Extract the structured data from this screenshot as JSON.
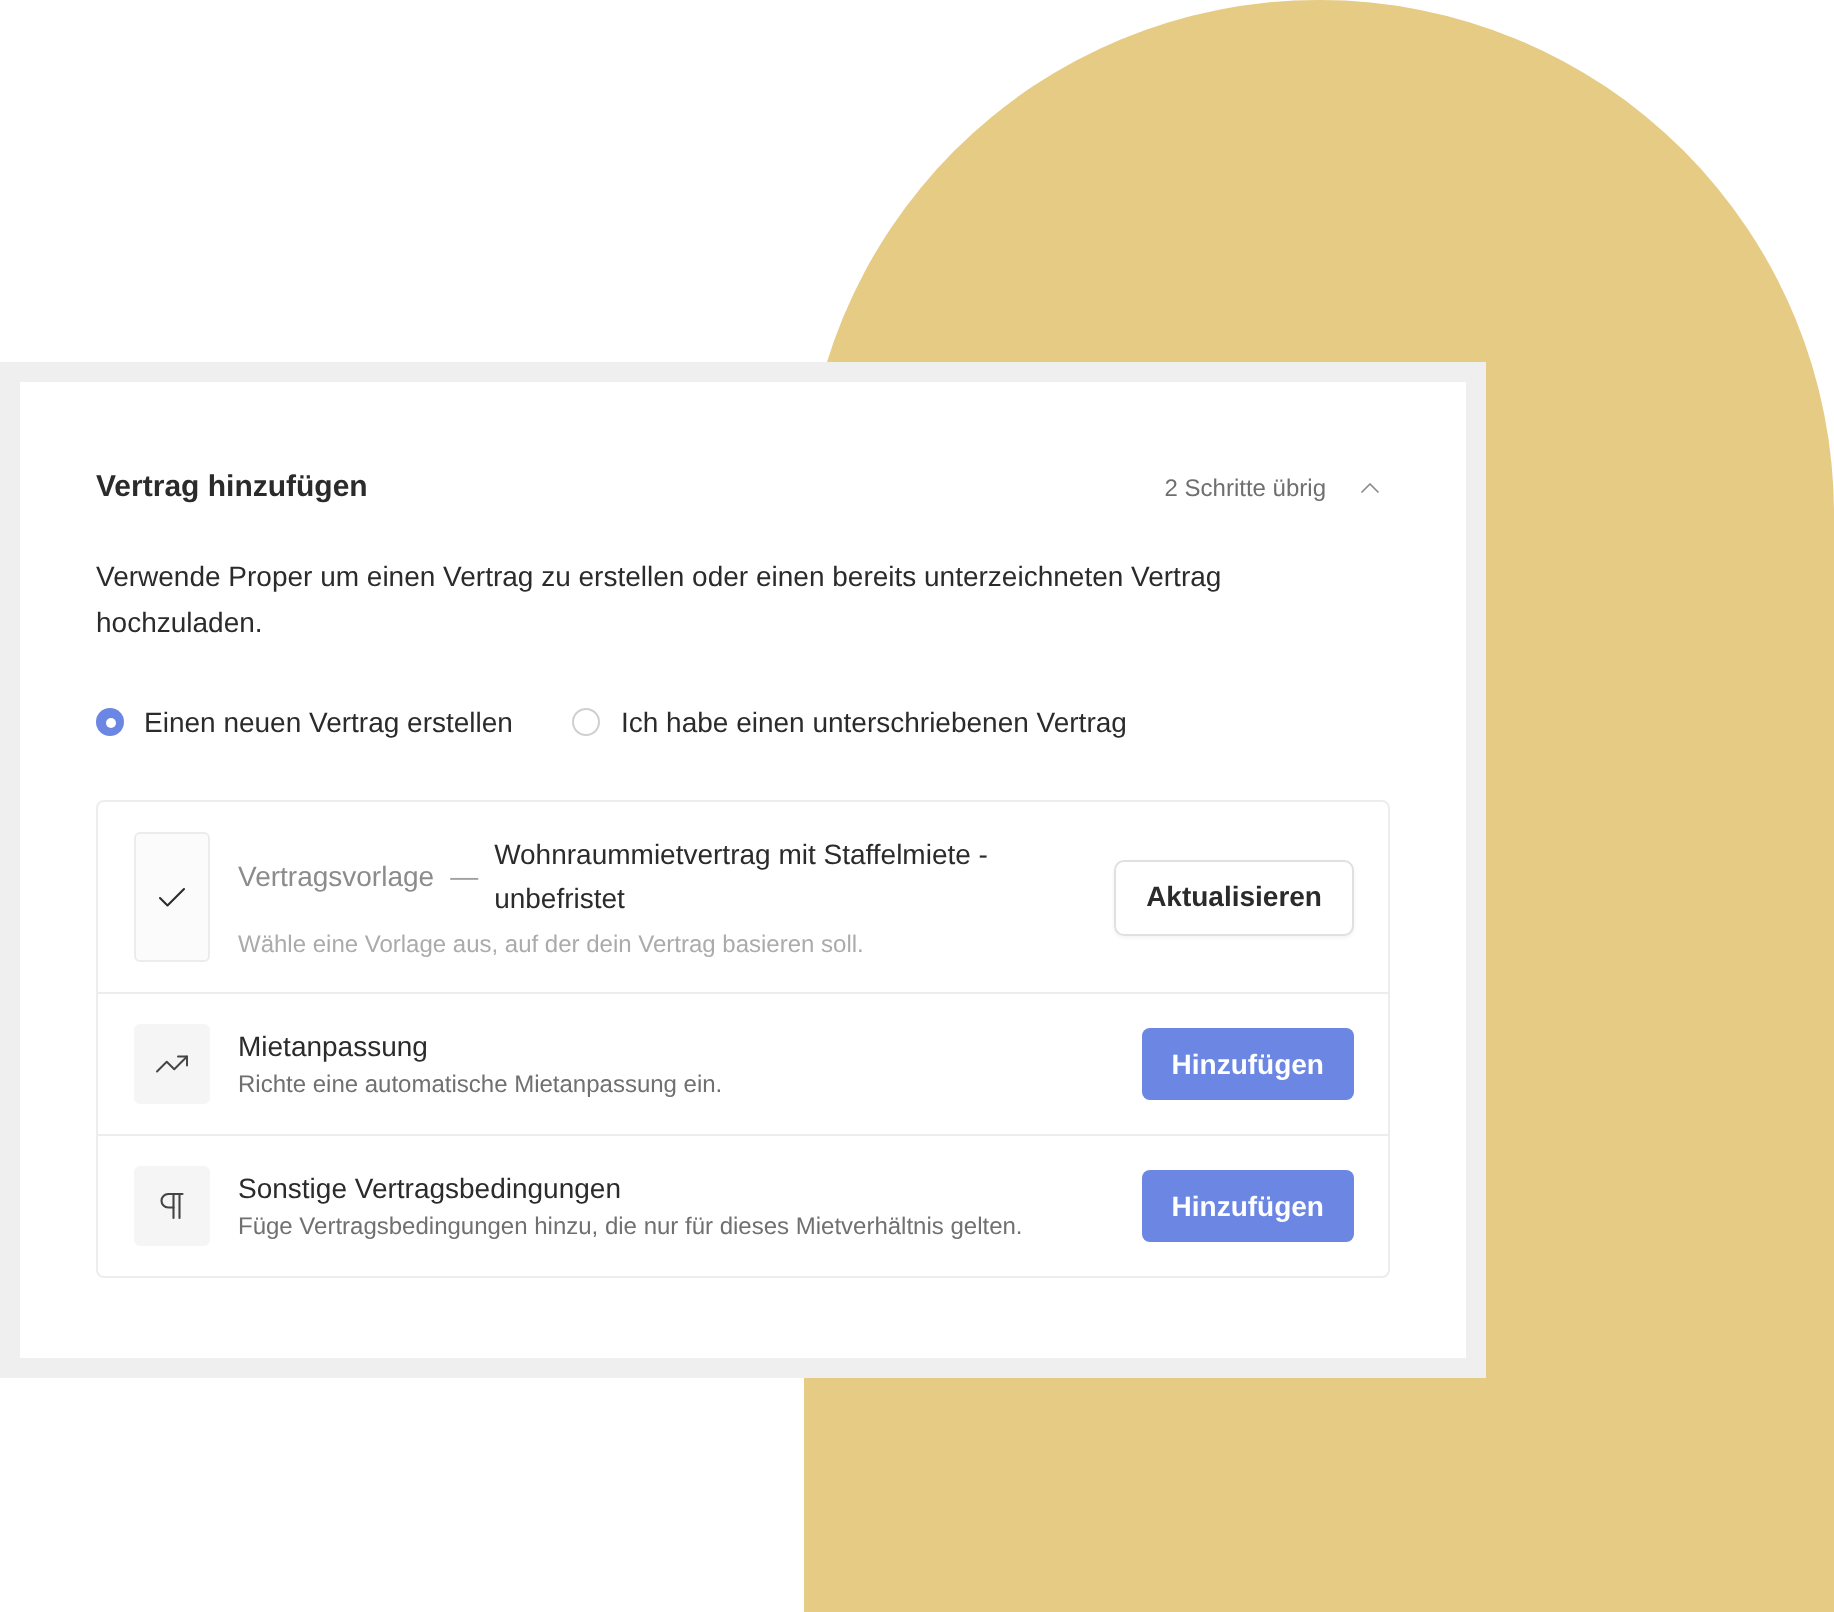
{
  "card": {
    "title": "Vertrag hinzufügen",
    "steps_left": "2 Schritte übrig",
    "expanded": true,
    "description": "Verwende Proper um einen Vertrag zu erstellen oder einen bereits unterzeichneten Vertrag hochzuladen.",
    "options": [
      {
        "label": "Einen neuen Vertrag erstellen",
        "selected": true
      },
      {
        "label": "Ich habe einen unterschriebenen Vertrag",
        "selected": false
      }
    ],
    "steps": [
      {
        "kind": "template",
        "done": true,
        "label": "Vertragsvorlage",
        "separator": "—",
        "value": "Wohnraummietvertrag mit Staffelmiete - unbefristet",
        "hint": "Wähle eine Vorlage aus, auf der dein Vertrag basieren soll.",
        "button": {
          "label": "Aktualisieren",
          "primary": false
        }
      },
      {
        "kind": "rent",
        "done": false,
        "label": "Mietanpassung",
        "hint": "Richte eine automatische Mietanpassung ein.",
        "button": {
          "label": "Hinzufügen",
          "primary": true
        }
      },
      {
        "kind": "terms",
        "done": false,
        "label": "Sonstige Vertragsbedingungen",
        "hint": "Füge Vertragsbedingungen hinzu, die nur für dieses Mietverhältnis gelten.",
        "button": {
          "label": "Hinzufügen",
          "primary": true
        }
      }
    ]
  }
}
